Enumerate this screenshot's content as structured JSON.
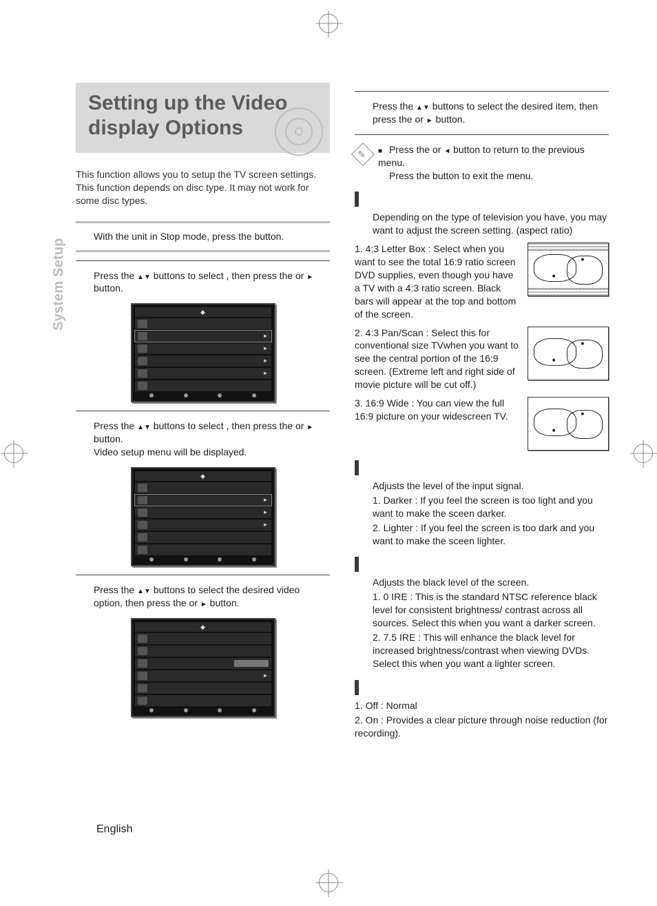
{
  "side_tab": "System Setup",
  "title": "Setting up the Video display Options",
  "intro": "This function allows you to setup the TV screen settings. This function depends on disc type. It may not work for some disc types.",
  "left": {
    "step1": {
      "pre": "With the unit in Stop mode, press the",
      "post": "button."
    },
    "step2": {
      "pre": "Press the ",
      "mid": " buttons to select",
      "post2": ", then press the",
      "post3": " or ",
      "post4": " button."
    },
    "step3": {
      "pre": "Press the ",
      "mid": " buttons to select",
      "post2": ", then press the",
      "post3": " or ",
      "post4": " button.",
      "extra": "Video setup menu will be displayed."
    },
    "step4": {
      "pre": "Press the ",
      "mid": " buttons to select the desired video option, then press the",
      "post3": " or ",
      "post4": " button."
    }
  },
  "right": {
    "step5": {
      "pre": "Press the ",
      "mid": " buttons to select the desired item, then press the",
      "post3": " or ",
      "post4": " button."
    },
    "note": {
      "line1_pre": "Press the",
      "line1_mid": " or ",
      "line1_post": " button to return to the previous menu.",
      "line2_pre": "Press the",
      "line2_post": " button to exit the menu."
    },
    "sec_tv": {
      "intro": "Depending on the type of television you have, you may want to adjust the screen setting. (aspect ratio)",
      "opt1": "1.   4:3 Letter  Box : Select when you want to see the total 16:9 ratio screen DVD supplies, even though you have a TV with a 4:3 ratio screen. Black bars will appear at the top and bottom of the screen.",
      "opt2": "2.   4:3 Pan/Scan : Select this for conventional size TVwhen you want to see the central portion of the 16:9 screen. (Extreme left and right side of movie picture will be cut off.)",
      "opt3": "3.   16:9 Wide : You can view the full 16:9 picture on your widescreen TV."
    },
    "sec_video": {
      "intro": "Adjusts the level of the input signal.",
      "l1": "1. Darker : If you feel the screen is too light and you want to make the sceen darker.",
      "l2": "2. Lighter : If you feel the screen is too dark and you want to make the sceen lighter."
    },
    "sec_black": {
      "intro": "Adjusts the black level of the screen.",
      "l1": "1. 0 IRE : This is the standard NTSC reference black level for consistent brightness/ contrast across all sources. Select this when you want a darker screen.",
      "l2": "2. 7.5 IRE : This will  enhance the black level for increased brightness/contrast when viewing DVDs. Select this when you want a lighter screen."
    },
    "sec_nr": {
      "l1": "1. Off : Normal",
      "l2": "2. On : Provides a clear picture through noise reduction (for recording)."
    }
  },
  "footer_lang": "English"
}
